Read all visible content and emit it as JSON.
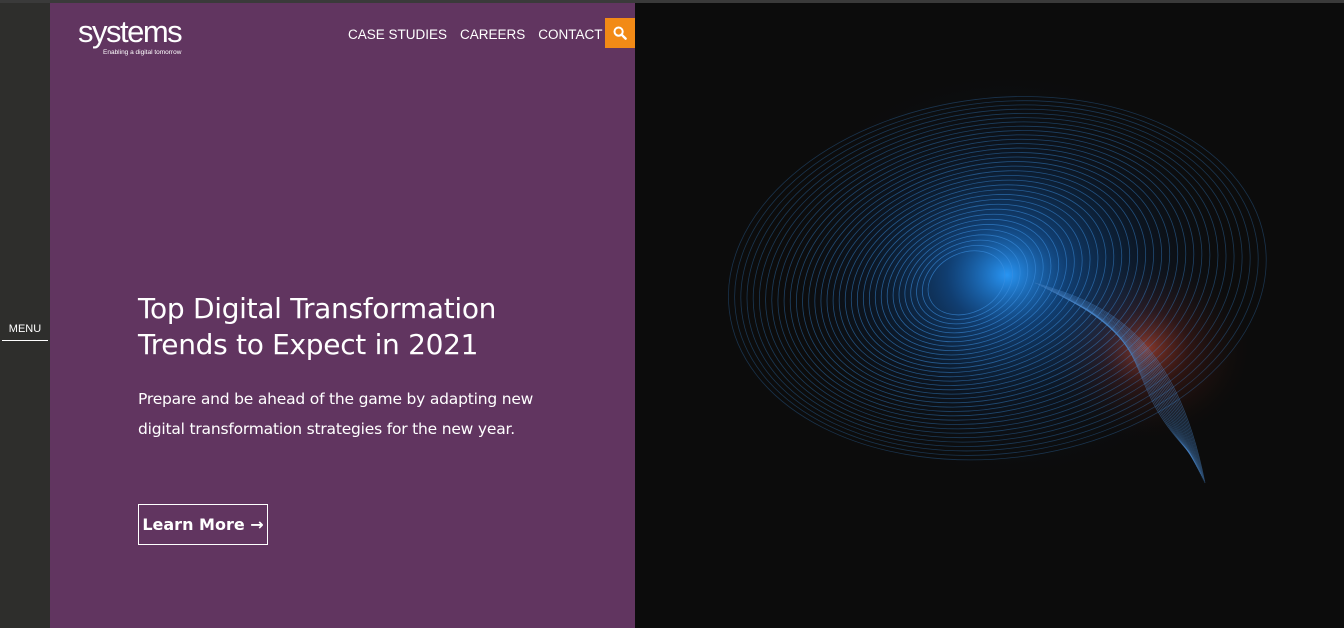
{
  "brand": {
    "logo_text": "systems",
    "tagline": "Enabling a digital tomorrow"
  },
  "nav": {
    "items": [
      {
        "label": "CASE STUDIES"
      },
      {
        "label": "CAREERS"
      },
      {
        "label": "CONTACT US"
      }
    ],
    "search_icon": "search-icon"
  },
  "sidebar": {
    "menu_label": "MENU"
  },
  "hero": {
    "title": "Top Digital Transformation Trends to Expect in 2021",
    "description": "Prepare and be ahead of the game by adapting new digital transformation strategies for the new year.",
    "cta_label": "Learn More →"
  },
  "colors": {
    "panel": "#613560",
    "accent": "#f28a16",
    "rail": "#2e2e2c",
    "visual_bg": "#0c0c0c",
    "swirl_blue": "#2a8fe6",
    "swirl_red": "#c0442a"
  }
}
